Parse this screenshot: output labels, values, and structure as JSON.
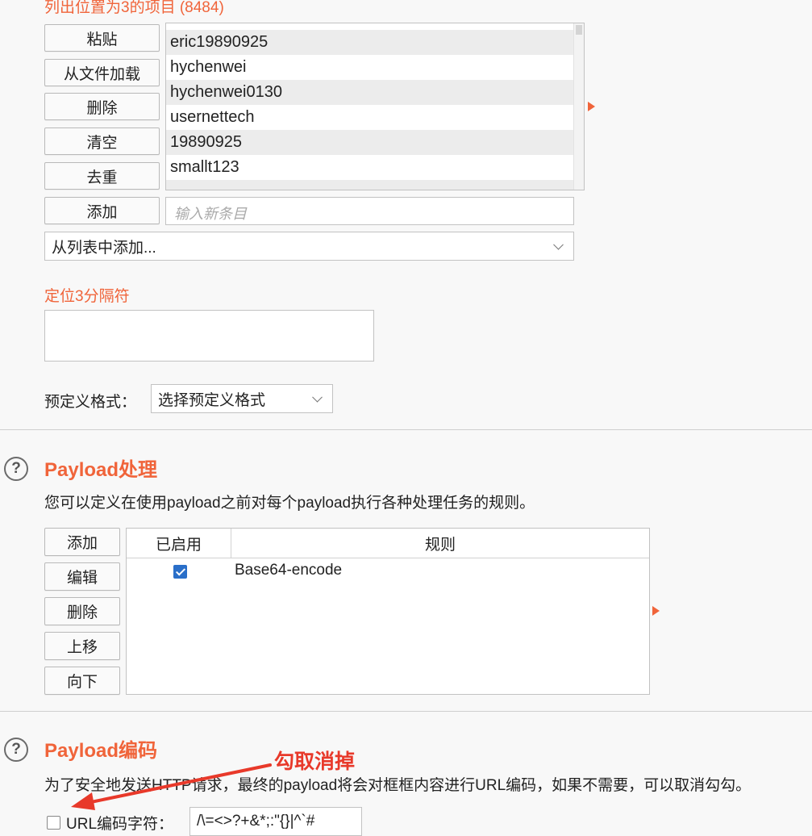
{
  "payload_list": {
    "header": "列出位置为3的项目 (8484)",
    "buttons": {
      "paste": "粘贴",
      "load": "从文件加载",
      "remove": "删除",
      "clear": "清空",
      "dedupe": "去重",
      "add": "添加"
    },
    "items": [
      "eric19890925",
      "hychenwei",
      "hychenwei0130",
      "usernettech",
      "19890925",
      "smallt123"
    ],
    "add_placeholder": "输入新条目",
    "add_from_list": "从列表中添加..."
  },
  "separator": {
    "label": "定位3分隔符",
    "predefined_label": "预定义格式：",
    "predefined_select": "选择预定义格式"
  },
  "processing": {
    "title": "Payload处理",
    "description": "您可以定义在使用payload之前对每个payload执行各种处理任务的规则。",
    "buttons": {
      "add": "添加",
      "edit": "编辑",
      "remove": "删除",
      "up": "上移",
      "down": "向下"
    },
    "columns": [
      "已启用",
      "规则"
    ],
    "rules": [
      {
        "enabled": true,
        "rule": "Base64-encode"
      }
    ]
  },
  "encoding": {
    "title": "Payload编码",
    "annotation": "勾取消掉",
    "description": "为了安全地发送HTTP请求，最终的payload将会对框框内容进行URL编码，如果不需要，可以取消勾勾。",
    "checkbox_label": "URL编码字符：",
    "checkbox_checked": false,
    "chars_value": "/\\=<>?+&*;:\"{}|^`#"
  },
  "colors": {
    "accent": "#f0643a",
    "annotation": "#e8392a",
    "checkbox": "#2a6fc9"
  }
}
